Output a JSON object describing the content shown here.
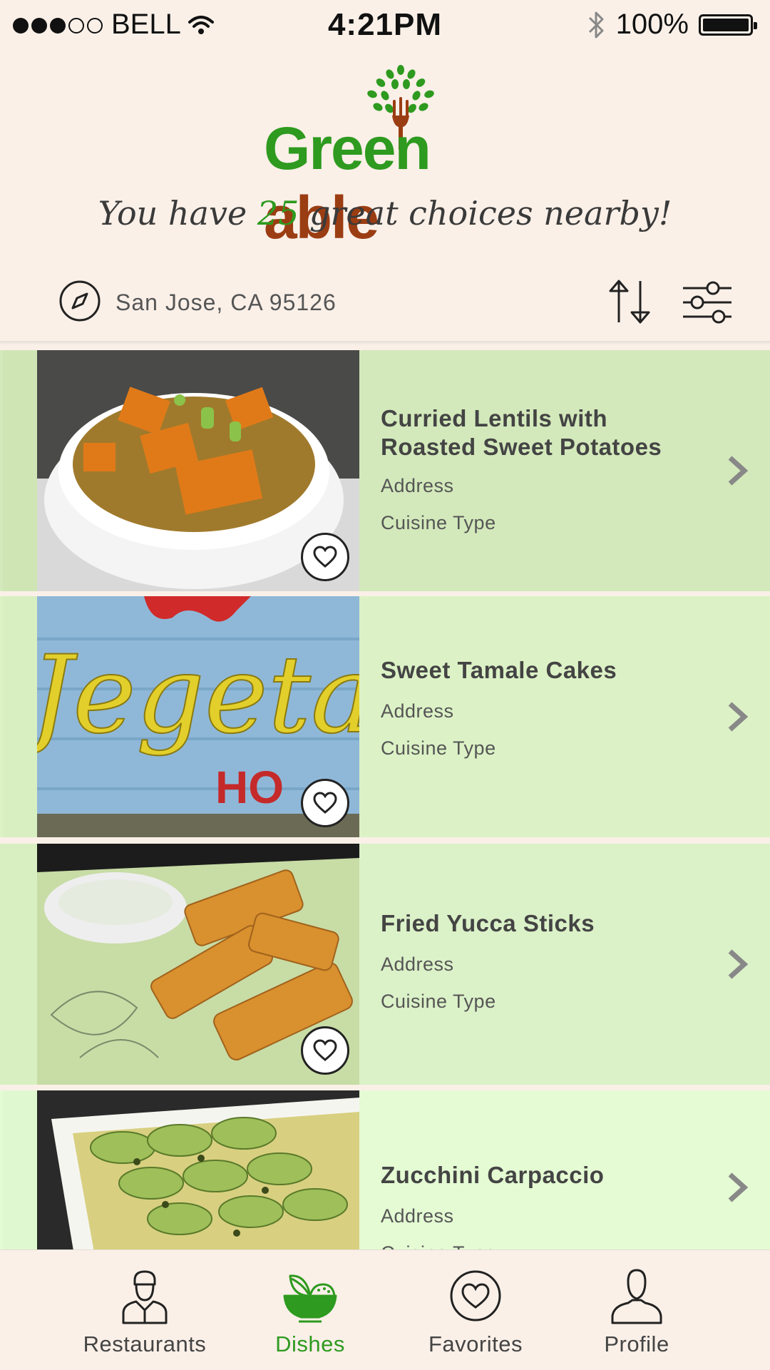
{
  "status_bar": {
    "carrier": "BELL",
    "time": "4:21PM",
    "battery": "100%",
    "signal_bars_filled": 3,
    "signal_bars_total": 5,
    "battery_level": 1.0
  },
  "header": {
    "logo_text_green": "Green",
    "logo_text_brown": "able",
    "tagline_before": "You have ",
    "tagline_count": "25",
    "tagline_after": " great choices nearby!"
  },
  "location": {
    "text": "San Jose, CA  95126"
  },
  "dishes": [
    {
      "title": "Curried Lentils with Roasted Sweet Potatoes",
      "address": "Address",
      "cuisine": "Cuisine Type"
    },
    {
      "title": "Sweet Tamale Cakes",
      "address": "Address",
      "cuisine": "Cuisine Type"
    },
    {
      "title": "Fried Yucca Sticks",
      "address": "Address",
      "cuisine": "Cuisine Type"
    },
    {
      "title": "Zucchini Carpaccio",
      "address": "Address",
      "cuisine": "Cuisine Type"
    }
  ],
  "tabs": [
    {
      "label": "Restaurants",
      "icon": "chef-icon"
    },
    {
      "label": "Dishes",
      "icon": "bowl-icon",
      "active": true
    },
    {
      "label": "Favorites",
      "icon": "heart-icon"
    },
    {
      "label": "Profile",
      "icon": "person-icon"
    }
  ],
  "colors": {
    "brand_green": "#2e9a1f",
    "brand_brown": "#9b3d12",
    "background": "#faf0e8",
    "row_green_1": "#d3e9bb",
    "row_green_2": "#dcf2c6",
    "row_green_3": "#dbf1c8",
    "row_green_4": "#e4fbd3"
  }
}
